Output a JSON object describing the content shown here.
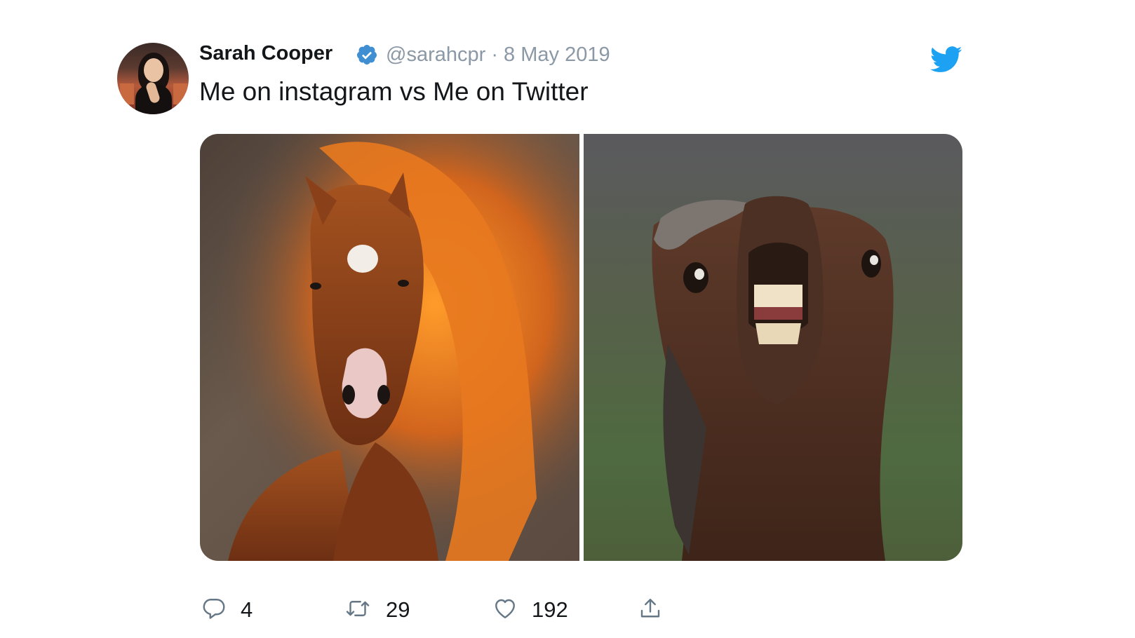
{
  "tweet": {
    "author_name": "Sarah Cooper",
    "handle_and_date": "@sarahcpr · 8 May 2019",
    "text": "Me on instagram vs Me on Twitter",
    "images": [
      {
        "label": "horse with flowing mane"
      },
      {
        "label": "horse baring teeth"
      }
    ]
  },
  "stats": {
    "replies": "4",
    "retweets": "29",
    "likes": "192"
  },
  "icons": {
    "verified": "verified-badge-icon",
    "brand": "twitter-bird-icon",
    "reply": "reply-icon",
    "retweet": "retweet-icon",
    "like": "heart-icon",
    "share": "share-icon"
  },
  "colors": {
    "brand_blue": "#1da1f2",
    "verified_blue": "#3f8fd2",
    "muted_text": "#8b98a5",
    "icon_gray": "#657786"
  }
}
